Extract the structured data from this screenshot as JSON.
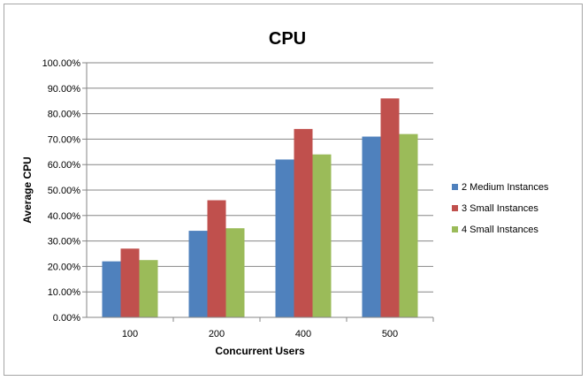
{
  "chart_data": {
    "type": "bar",
    "title": "CPU",
    "xlabel": "Concurrent Users",
    "ylabel": "Average CPU",
    "categories": [
      "100",
      "200",
      "400",
      "500"
    ],
    "series": [
      {
        "name": "2 Medium Instances",
        "color": "#4f81bd",
        "values": [
          22,
          34,
          62,
          71
        ]
      },
      {
        "name": "3 Small Instances",
        "color": "#c0504d",
        "values": [
          27,
          46,
          74,
          86
        ]
      },
      {
        "name": "4 Small Instances",
        "color": "#9bbb59",
        "values": [
          22.5,
          35,
          64,
          72
        ]
      }
    ],
    "ylim": [
      0,
      100
    ],
    "yticks": [
      "0.00%",
      "10.00%",
      "20.00%",
      "30.00%",
      "40.00%",
      "50.00%",
      "60.00%",
      "70.00%",
      "80.00%",
      "90.00%",
      "100.00%"
    ],
    "grid": true,
    "legend_position": "right"
  }
}
